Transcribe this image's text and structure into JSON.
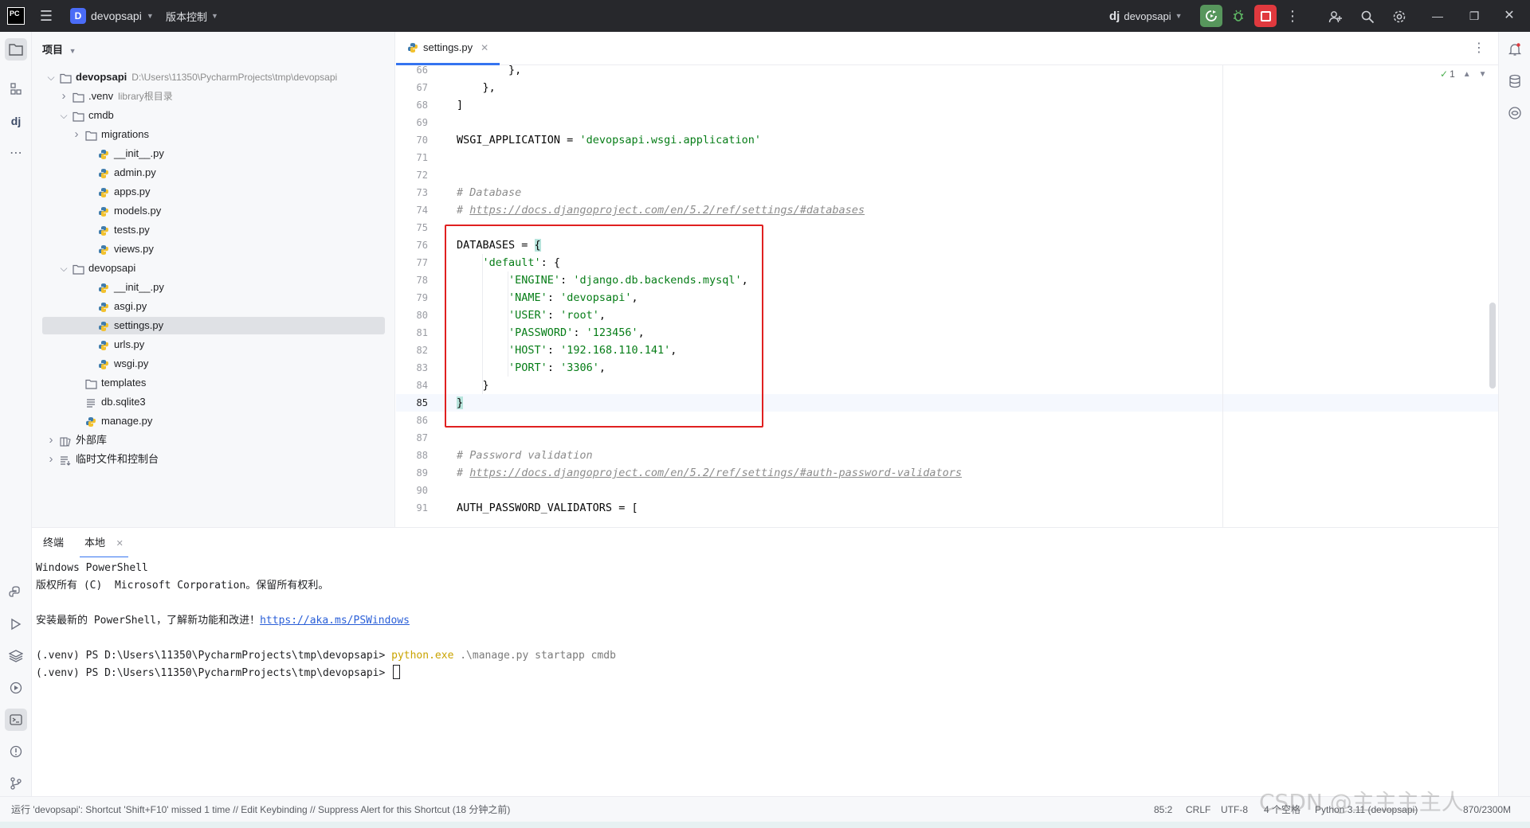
{
  "titlebar": {
    "app_logo": "PC",
    "project_badge": "D",
    "project_name": "devopsapi",
    "vcs_label": "版本控制",
    "run_config_logo": "dj",
    "run_config": "devopsapi",
    "icons": [
      "hamburger-menu-icon",
      "run-icon",
      "debug-icon",
      "stop-icon",
      "more-icon",
      "add-user-icon",
      "search-icon",
      "gear-icon",
      "minimize-icon",
      "restore-icon",
      "close-icon"
    ]
  },
  "project_panel": {
    "header": "项目",
    "tree": [
      {
        "label": "devopsapi",
        "sub": "D:\\Users\\11350\\PycharmProjects\\tmp\\devopsapi",
        "bold": true
      },
      {
        "label": ".venv",
        "sub": "library根目录"
      },
      {
        "label": "cmdb"
      },
      {
        "label": "migrations"
      },
      {
        "label": "__init__.py"
      },
      {
        "label": "admin.py"
      },
      {
        "label": "apps.py"
      },
      {
        "label": "models.py"
      },
      {
        "label": "tests.py"
      },
      {
        "label": "views.py"
      },
      {
        "label": "devopsapi"
      },
      {
        "label": "__init__.py"
      },
      {
        "label": "asgi.py"
      },
      {
        "label": "settings.py"
      },
      {
        "label": "urls.py"
      },
      {
        "label": "wsgi.py"
      },
      {
        "label": "templates"
      },
      {
        "label": "db.sqlite3"
      },
      {
        "label": "manage.py"
      },
      {
        "label": "外部库"
      },
      {
        "label": "临时文件和控制台"
      }
    ]
  },
  "editor": {
    "tab_label": "settings.py",
    "inspection_count": "1",
    "lines": [
      {
        "n": "66",
        "text": "        },"
      },
      {
        "n": "67",
        "text": "    },"
      },
      {
        "n": "68",
        "text": "]"
      },
      {
        "n": "69",
        "text": ""
      },
      {
        "n": "70",
        "text": "WSGI_APPLICATION = 'devopsapi.wsgi.application'"
      },
      {
        "n": "71",
        "text": ""
      },
      {
        "n": "72",
        "text": ""
      },
      {
        "n": "73",
        "text": "# Database"
      },
      {
        "n": "74",
        "text": "# https://docs.djangoproject.com/en/5.2/ref/settings/#databases"
      },
      {
        "n": "75",
        "text": ""
      },
      {
        "n": "76",
        "text": "DATABASES = {"
      },
      {
        "n": "77",
        "text": "    'default': {"
      },
      {
        "n": "78",
        "text": "        'ENGINE': 'django.db.backends.mysql',"
      },
      {
        "n": "79",
        "text": "        'NAME': 'devopsapi',"
      },
      {
        "n": "80",
        "text": "        'USER': 'root',"
      },
      {
        "n": "81",
        "text": "        'PASSWORD': '123456',"
      },
      {
        "n": "82",
        "text": "        'HOST': '192.168.110.141',"
      },
      {
        "n": "83",
        "text": "        'PORT': '3306',"
      },
      {
        "n": "84",
        "text": "    }"
      },
      {
        "n": "85",
        "text": "}"
      },
      {
        "n": "86",
        "text": ""
      },
      {
        "n": "87",
        "text": ""
      },
      {
        "n": "88",
        "text": "# Password validation"
      },
      {
        "n": "89",
        "text": "# https://docs.djangoproject.com/en/5.2/ref/settings/#auth-password-validators"
      },
      {
        "n": "90",
        "text": ""
      },
      {
        "n": "91",
        "text": "AUTH_PASSWORD_VALIDATORS = ["
      }
    ]
  },
  "terminal": {
    "tab_terminal": "终端",
    "tab_local": "本地",
    "lines": {
      "l1": "Windows PowerShell",
      "l2": "版权所有 (C)  Microsoft Corporation。保留所有权利。",
      "l3_prefix": "安装最新的 PowerShell，了解新功能和改进！",
      "l3_link": "https://aka.ms/PSWindows",
      "prompt": "(.venv) PS D:\\Users\\11350\\PycharmProjects\\tmp\\devopsapi> ",
      "cmd": "python.exe",
      "cmd_args": " .\\manage.py startapp cmdb"
    }
  },
  "statusbar": {
    "message": "运行 'devopsapi': Shortcut 'Shift+F10' missed 1 time // Edit Keybinding // Suppress Alert for this Shortcut (18 分钟之前)",
    "position": "85:2",
    "line_sep": "CRLF",
    "encoding": "UTF-8",
    "indent": "4 个空格",
    "interpreter": "Python 3.11 (devopsapi)",
    "memory": "870/2300M"
  },
  "watermark": "CSDN @主主主主人"
}
